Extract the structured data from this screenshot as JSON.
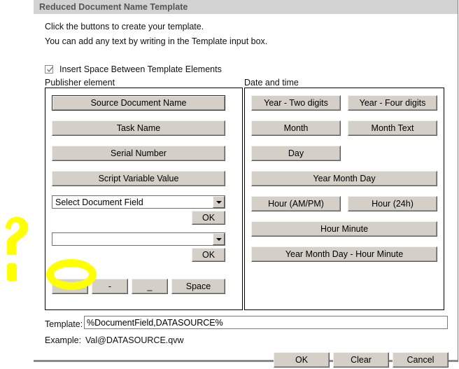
{
  "window": {
    "title": "Reduced Document Name Template"
  },
  "instructions": {
    "line1": "Click the buttons to create your template.",
    "line2": "You can add any text by writing in the Template input box."
  },
  "insert_space_checkbox": {
    "label": "Insert Space Between Template Elements",
    "checked": true
  },
  "publisher_group": {
    "label": "Publisher element",
    "buttons": [
      {
        "label": "Source Document Name",
        "default": true
      },
      {
        "label": "Task Name",
        "default": false
      },
      {
        "label": "Serial Number",
        "default": false
      },
      {
        "label": "Script Variable Value",
        "default": false
      }
    ],
    "combo1": {
      "value": "Select Document Field"
    },
    "ok1": "OK",
    "combo2": {
      "value": ""
    },
    "ok2": "OK",
    "separator_buttons": [
      {
        "label": "\\",
        "highlighted": true
      },
      {
        "label": "-",
        "highlighted": false
      },
      {
        "label": "_",
        "highlighted": false
      },
      {
        "label": "Space",
        "highlighted": false
      }
    ]
  },
  "datetime_group": {
    "label": "Date and time",
    "buttons": [
      {
        "label": "Year - Two digits"
      },
      {
        "label": "Year - Four digits"
      },
      {
        "label": "Month"
      },
      {
        "label": "Month Text"
      },
      {
        "label": "Day"
      },
      {
        "label": "Year Month Day"
      },
      {
        "label": "Hour (AM/PM)"
      },
      {
        "label": "Hour (24h)"
      },
      {
        "label": "Hour Minute"
      },
      {
        "label": "Year Month Day - Hour Minute"
      }
    ]
  },
  "template_row": {
    "label": "Template:",
    "value": "%DocumentField,DATASOURCE%"
  },
  "example_row": {
    "label": "Example:",
    "value": "Val@DATASOURCE.qvw"
  },
  "footer": {
    "ok": "OK",
    "clear": "Clear",
    "cancel": "Cancel"
  },
  "annotations": {
    "highlight_color": "#ffff00",
    "question_mark": "?",
    "ellipse_target": "backslash-button"
  }
}
